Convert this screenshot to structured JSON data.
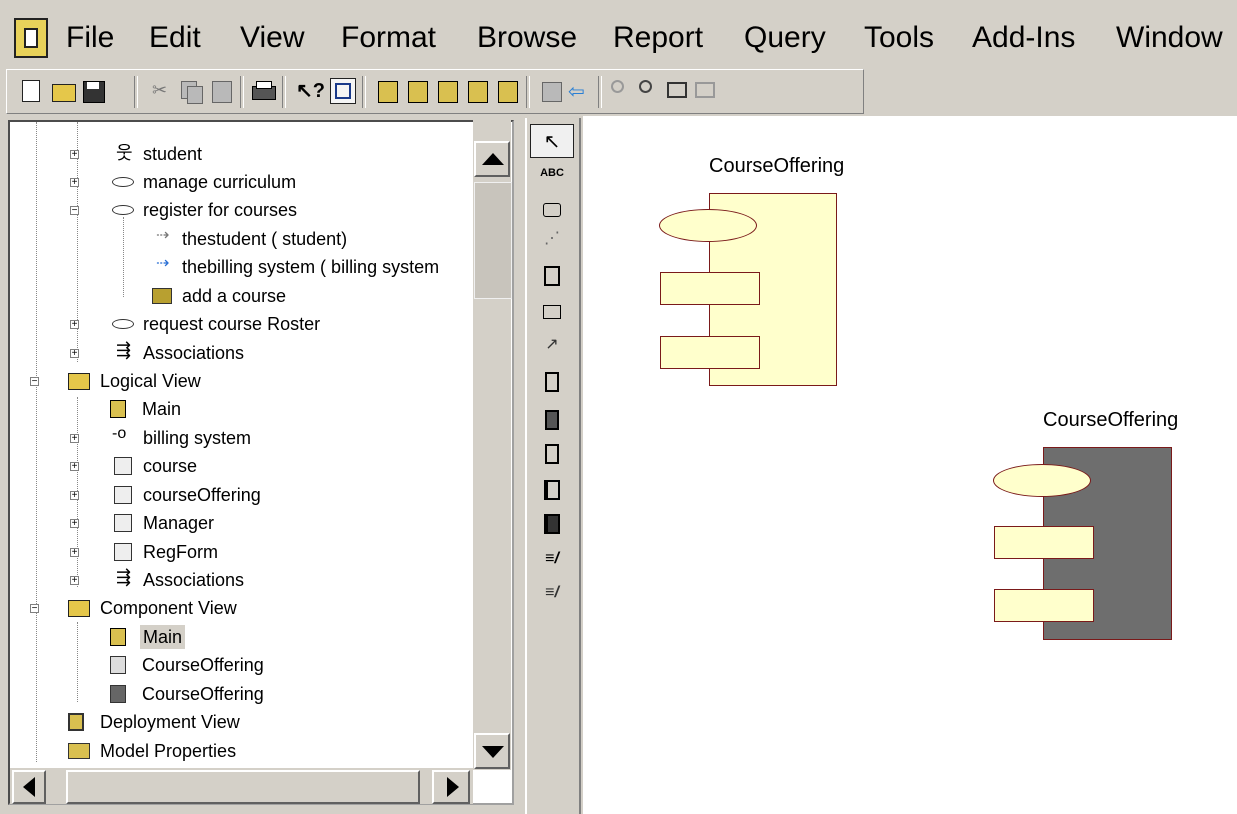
{
  "menu": {
    "items": [
      {
        "label": "File"
      },
      {
        "label": "Edit"
      },
      {
        "label": "View"
      },
      {
        "label": "Format"
      },
      {
        "label": "Browse"
      },
      {
        "label": "Report"
      },
      {
        "label": "Query"
      },
      {
        "label": "Tools"
      },
      {
        "label": "Add-Ins"
      },
      {
        "label": "Window"
      }
    ]
  },
  "toolbar": {
    "buttons": [
      "new-icon",
      "open-icon",
      "save-icon",
      "cut-icon",
      "copy-icon",
      "paste-icon",
      "print-icon",
      "context-help-icon",
      "view-doc-icon",
      "browse-class-diagram-icon",
      "browse-interaction-diagram-icon",
      "browse-component-diagram-icon",
      "browse-state-diagram-icon",
      "browse-deployment-diagram-icon",
      "browse-parent-icon",
      "browse-previous-icon",
      "zoom-in-icon",
      "zoom-out-icon",
      "fit-in-window-icon",
      "undo-fit-icon"
    ]
  },
  "tree": {
    "rows": [
      {
        "label": "student",
        "icon": "actor-icon"
      },
      {
        "label": "manage curriculum",
        "icon": "use-case-icon"
      },
      {
        "label": "register for courses",
        "icon": "use-case-icon"
      },
      {
        "label": "thestudent ( student)",
        "icon": "association-role-icon"
      },
      {
        "label": "thebilling system ( billing system",
        "icon": "association-role-icon"
      },
      {
        "label": "add a course",
        "icon": "interaction-diagram-icon"
      },
      {
        "label": "request course Roster",
        "icon": "use-case-icon"
      },
      {
        "label": "Associations",
        "icon": "associations-icon"
      },
      {
        "label": "Logical View",
        "icon": "folder-icon"
      },
      {
        "label": "Main",
        "icon": "class-diagram-icon"
      },
      {
        "label": "billing system",
        "icon": "interface-icon"
      },
      {
        "label": "course",
        "icon": "class-icon"
      },
      {
        "label": "courseOffering",
        "icon": "class-icon"
      },
      {
        "label": "Manager",
        "icon": "class-icon"
      },
      {
        "label": "RegForm",
        "icon": "class-icon"
      },
      {
        "label": "Associations",
        "icon": "associations-icon"
      },
      {
        "label": "Component View",
        "icon": "folder-icon"
      },
      {
        "label": "Main",
        "icon": "component-diagram-icon"
      },
      {
        "label": "CourseOffering",
        "icon": "package-spec-icon"
      },
      {
        "label": "CourseOffering",
        "icon": "package-body-icon"
      },
      {
        "label": "Deployment View",
        "icon": "deployment-icon"
      },
      {
        "label": "Model Properties",
        "icon": "model-properties-icon"
      }
    ]
  },
  "palette": {
    "text_tool_label": "ABC",
    "tools": [
      "selection-tool-icon",
      "text-tool-icon",
      "note-icon",
      "anchor-note-icon",
      "component-icon",
      "package-icon",
      "dependency-icon",
      "subprogram-spec-icon",
      "subprogram-body-icon",
      "main-program-icon",
      "package-spec-icon",
      "package-body-icon",
      "task-spec-icon",
      "task-body-icon"
    ]
  },
  "diagram": {
    "components": [
      {
        "label": "CourseOffering",
        "kind": "package specification",
        "fill": "#ffffcc"
      },
      {
        "label": "CourseOffering",
        "kind": "package body",
        "fill": "#6e6e6e"
      }
    ]
  },
  "colors": {
    "chrome": "#d4d0c8",
    "component_fill": "#ffffcc",
    "component_border": "#7a1a1a",
    "body_fill": "#6e6e6e",
    "selection": "#d4d0c8"
  }
}
